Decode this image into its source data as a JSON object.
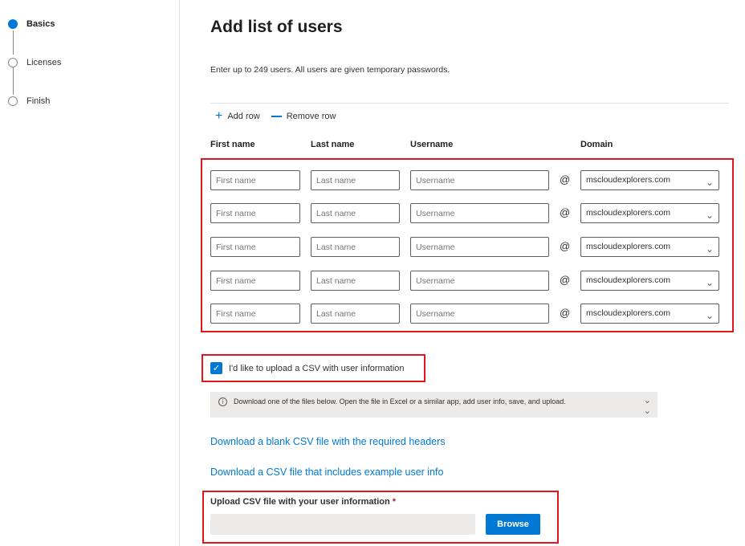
{
  "stepper": {
    "steps": [
      {
        "label": "Basics",
        "active": true
      },
      {
        "label": "Licenses",
        "active": false
      },
      {
        "label": "Finish",
        "active": false
      }
    ]
  },
  "page": {
    "title": "Add list of users",
    "subtitle": "Enter up to 249 users. All users are given temporary passwords."
  },
  "toolbar": {
    "add_row": "Add row",
    "remove_row": "Remove row"
  },
  "columns": {
    "first_name": "First name",
    "last_name": "Last name",
    "username": "Username",
    "domain": "Domain"
  },
  "rows": [
    {
      "first_name_placeholder": "First name",
      "last_name_placeholder": "Last name",
      "username_placeholder": "Username",
      "at": "@",
      "domain": "mscloudexplorers.com"
    },
    {
      "first_name_placeholder": "First name",
      "last_name_placeholder": "Last name",
      "username_placeholder": "Username",
      "at": "@",
      "domain": "mscloudexplorers.com"
    },
    {
      "first_name_placeholder": "First name",
      "last_name_placeholder": "Last name",
      "username_placeholder": "Username",
      "at": "@",
      "domain": "mscloudexplorers.com"
    },
    {
      "first_name_placeholder": "First name",
      "last_name_placeholder": "Last name",
      "username_placeholder": "Username",
      "at": "@",
      "domain": "mscloudexplorers.com"
    },
    {
      "first_name_placeholder": "First name",
      "last_name_placeholder": "Last name",
      "username_placeholder": "Username",
      "at": "@",
      "domain": "mscloudexplorers.com"
    }
  ],
  "csv": {
    "checkbox_label": "I'd like to upload a CSV with user information",
    "checked": true,
    "info_text": "Download one of the files below. Open the file in Excel or a similar app, add user info, save, and upload.",
    "link_blank": "Download a blank CSV file with the required headers",
    "link_example": "Download a CSV file that includes example user info",
    "upload_label": "Upload CSV file with your user information",
    "required_marker": "*",
    "browse_label": "Browse"
  },
  "colors": {
    "accent": "#0078d4",
    "highlight": "#e3151a"
  }
}
